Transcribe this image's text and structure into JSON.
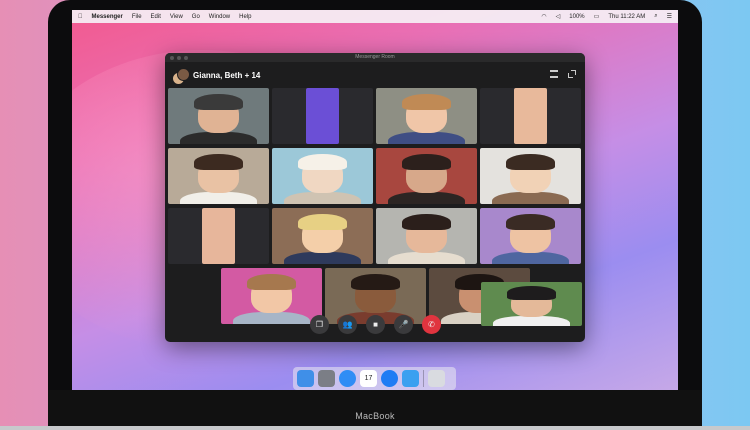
{
  "menubar": {
    "apple_icon": "apple-icon",
    "app_name": "Messenger",
    "menus": [
      "File",
      "Edit",
      "View",
      "Go",
      "Window",
      "Help"
    ],
    "battery": "100%",
    "clock": "Thu 11:22 AM"
  },
  "window": {
    "title": "Messenger Room",
    "room_name": "Gianna, Beth + 14"
  },
  "controls": [
    {
      "name": "share-screen-icon",
      "glyph": "❐"
    },
    {
      "name": "participants-icon",
      "glyph": "👥"
    },
    {
      "name": "video-camera-icon",
      "glyph": "■"
    },
    {
      "name": "microphone-icon",
      "glyph": "🎤"
    },
    {
      "name": "end-call-icon",
      "glyph": "✆"
    }
  ],
  "dock": {
    "calendar_day": "17",
    "apps": [
      "finder-icon",
      "system-preferences-icon",
      "messages-icon",
      "calendar-icon",
      "messenger-icon",
      "app-store-icon",
      "trash-icon"
    ]
  },
  "device_label": "MacBook",
  "colors": {
    "window_bg": "#1d1d1e",
    "end_call": "#e0343f",
    "control_bg": "#3a3a3c"
  }
}
